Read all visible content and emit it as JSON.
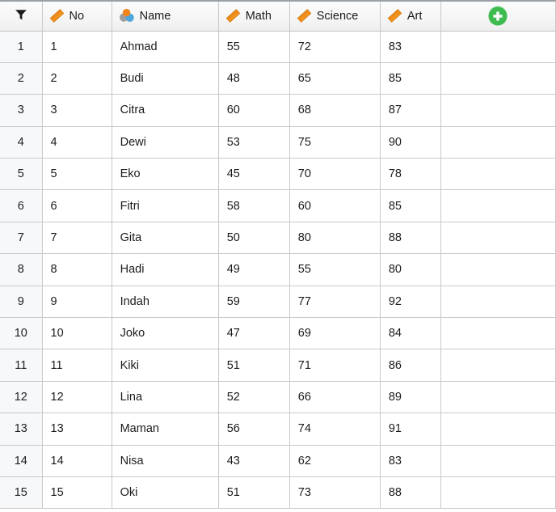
{
  "grid": {
    "filter_icon": "filter-funnel-icon",
    "add_column_icon": "plus-circle-icon",
    "add_column_label": "",
    "columns": [
      {
        "key": "rownum",
        "label": "",
        "icon": "filter-funnel-icon"
      },
      {
        "key": "no",
        "label": "No",
        "icon": "ruler-icon"
      },
      {
        "key": "name",
        "label": "Name",
        "icon": "people-icon"
      },
      {
        "key": "math",
        "label": "Math",
        "icon": "ruler-icon"
      },
      {
        "key": "science",
        "label": "Science",
        "icon": "ruler-icon"
      },
      {
        "key": "art",
        "label": "Art",
        "icon": "ruler-icon"
      },
      {
        "key": "add",
        "label": "",
        "icon": "plus-circle-icon"
      }
    ],
    "rows": [
      {
        "rownum": "1",
        "no": "1",
        "name": "Ahmad",
        "math": "55",
        "science": "72",
        "art": "83",
        "add": ""
      },
      {
        "rownum": "2",
        "no": "2",
        "name": "Budi",
        "math": "48",
        "science": "65",
        "art": "85",
        "add": ""
      },
      {
        "rownum": "3",
        "no": "3",
        "name": "Citra",
        "math": "60",
        "science": "68",
        "art": "87",
        "add": ""
      },
      {
        "rownum": "4",
        "no": "4",
        "name": "Dewi",
        "math": "53",
        "science": "75",
        "art": "90",
        "add": ""
      },
      {
        "rownum": "5",
        "no": "5",
        "name": "Eko",
        "math": "45",
        "science": "70",
        "art": "78",
        "add": ""
      },
      {
        "rownum": "6",
        "no": "6",
        "name": "Fitri",
        "math": "58",
        "science": "60",
        "art": "85",
        "add": ""
      },
      {
        "rownum": "7",
        "no": "7",
        "name": "Gita",
        "math": "50",
        "science": "80",
        "art": "88",
        "add": ""
      },
      {
        "rownum": "8",
        "no": "8",
        "name": "Hadi",
        "math": "49",
        "science": "55",
        "art": "80",
        "add": ""
      },
      {
        "rownum": "9",
        "no": "9",
        "name": "Indah",
        "math": "59",
        "science": "77",
        "art": "92",
        "add": ""
      },
      {
        "rownum": "10",
        "no": "10",
        "name": "Joko",
        "math": "47",
        "science": "69",
        "art": "84",
        "add": ""
      },
      {
        "rownum": "11",
        "no": "11",
        "name": "Kiki",
        "math": "51",
        "science": "71",
        "art": "86",
        "add": ""
      },
      {
        "rownum": "12",
        "no": "12",
        "name": "Lina",
        "math": "52",
        "science": "66",
        "art": "89",
        "add": ""
      },
      {
        "rownum": "13",
        "no": "13",
        "name": "Maman",
        "math": "56",
        "science": "74",
        "art": "91",
        "add": ""
      },
      {
        "rownum": "14",
        "no": "14",
        "name": "Nisa",
        "math": "43",
        "science": "62",
        "art": "83",
        "add": ""
      },
      {
        "rownum": "15",
        "no": "15",
        "name": "Oki",
        "math": "51",
        "science": "73",
        "art": "88",
        "add": ""
      }
    ]
  },
  "colors": {
    "ruler_orange": "#F4921E",
    "ruler_orange_dark": "#E07B12",
    "people_orange": "#F2851A",
    "people_gray": "#9E9E9E",
    "people_blue": "#4FA8DC",
    "add_green": "#3AB54A",
    "funnel_black": "#1b1b1b",
    "grid_line": "#c9c9c9",
    "rownum_bg": "#f7f8f9",
    "header_bg": "#f4f4f4",
    "top_border": "#9aa0a6"
  }
}
